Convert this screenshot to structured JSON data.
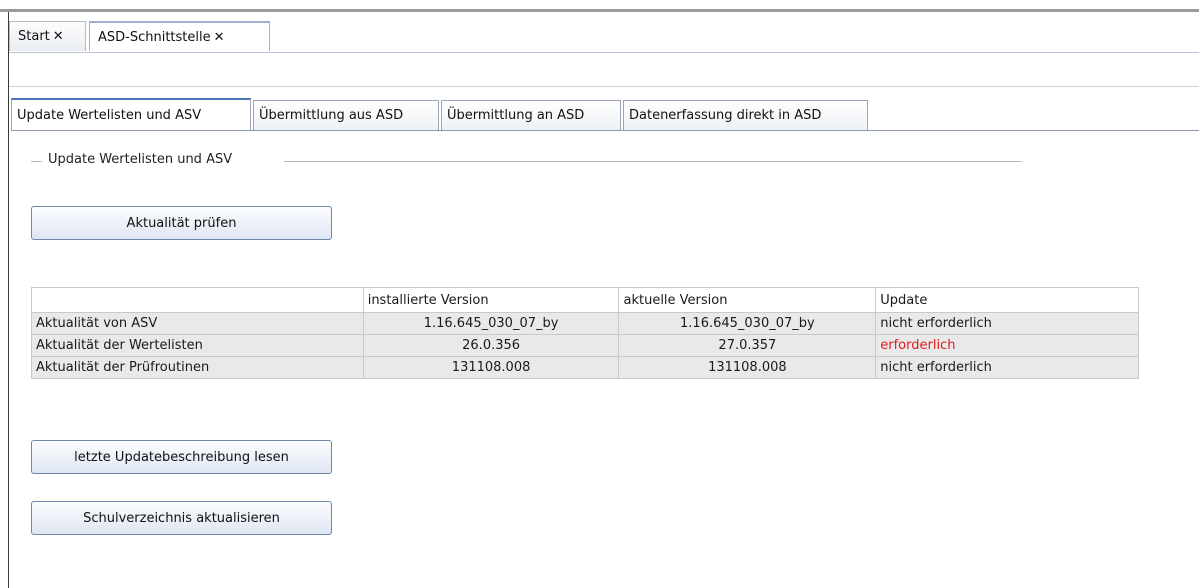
{
  "doc_tabs": [
    {
      "label": "Start",
      "close": "✕"
    },
    {
      "label": "ASD-Schnittstelle",
      "close": "✕"
    }
  ],
  "page_tabs": [
    {
      "label": "Update Wertelisten und ASV"
    },
    {
      "label": "Übermittlung aus ASD"
    },
    {
      "label": "Übermittlung an ASD"
    },
    {
      "label": "Datenerfassung direkt in ASD"
    }
  ],
  "group": {
    "title": "Update Wertelisten und ASV"
  },
  "buttons": {
    "check": "Aktualität prüfen",
    "read_description": "letzte Updatebeschreibung lesen",
    "update_school_directory": "Schulverzeichnis aktualisieren"
  },
  "table": {
    "columns": [
      "",
      "installierte Version",
      "aktuelle Version",
      "Update"
    ],
    "rows": [
      {
        "item": "Aktualität von ASV",
        "installed": "1.16.645_030_07_by",
        "current": "1.16.645_030_07_by",
        "update": "nicht erforderlich"
      },
      {
        "item": "Aktualität der Wertelisten",
        "installed": "26.0.356",
        "current": "27.0.357",
        "update": "erforderlich"
      },
      {
        "item": "Aktualität der Prüfroutinen",
        "installed": "131108.008",
        "current": "131108.008",
        "update": "nicht erforderlich"
      }
    ]
  },
  "colors": {
    "required": "#e31a1a",
    "active_tab_accent": "#4f74b3"
  }
}
